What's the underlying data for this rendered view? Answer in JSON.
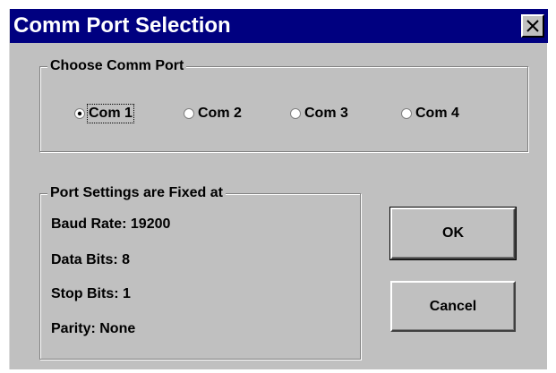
{
  "dialog": {
    "title": "Comm Port Selection",
    "close_icon": "close-icon"
  },
  "comm_port_group": {
    "label": "Choose Comm Port",
    "options": [
      {
        "label": "Com 1",
        "selected": true
      },
      {
        "label": "Com 2",
        "selected": false
      },
      {
        "label": "Com 3",
        "selected": false
      },
      {
        "label": "Com 4",
        "selected": false
      }
    ]
  },
  "settings_group": {
    "label": "Port Settings are Fixed at",
    "lines": [
      "Baud Rate: 19200",
      "Data Bits: 8",
      "Stop Bits: 1",
      "Parity: None"
    ]
  },
  "buttons": {
    "ok": "OK",
    "cancel": "Cancel"
  },
  "colors": {
    "title_bar": "#000080",
    "face": "#c0c0c0"
  }
}
